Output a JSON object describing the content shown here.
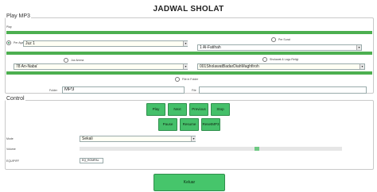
{
  "header": {
    "title": "JADWAL SHOLAT"
  },
  "play_mp3": {
    "group_label": "Play MP3",
    "mini_label": "Play",
    "per_ayat": {
      "label": "Per Ayat",
      "value": "Juz 1"
    },
    "per_surat": {
      "label": "Per Surat",
      "value": "1 Al-Fatihah"
    },
    "juz_amma": {
      "label": "Juz Amma",
      "value": "78 An-Naba'"
    },
    "sholawat": {
      "label": "Sholawat & Lagu Religi",
      "value": "001SholawatBadarDiahMaghfiroh"
    },
    "file_in_folder": {
      "label": "File in Folder"
    },
    "folder": {
      "label": "Folder",
      "value": "MP3"
    },
    "file": {
      "label": "File",
      "value": ""
    }
  },
  "control": {
    "group_label": "Control",
    "buttons_row1": [
      "Play",
      "Next",
      "Previous",
      "Stop"
    ],
    "buttons_row2": [
      "Pause",
      "Resume",
      "ResetMP3"
    ],
    "mode": {
      "label": "Mode",
      "value": "Sekali"
    },
    "volume": {
      "label": "Volume",
      "level": 0.68
    },
    "equalizer": {
      "label": "EQUIPIFF",
      "value": "EQ_ROMPAL"
    }
  },
  "footer": {
    "exit_label": "Keluar"
  },
  "colors": {
    "accent": "#4caf50",
    "button": "#45c06a",
    "field_bg": "#fffff4"
  }
}
